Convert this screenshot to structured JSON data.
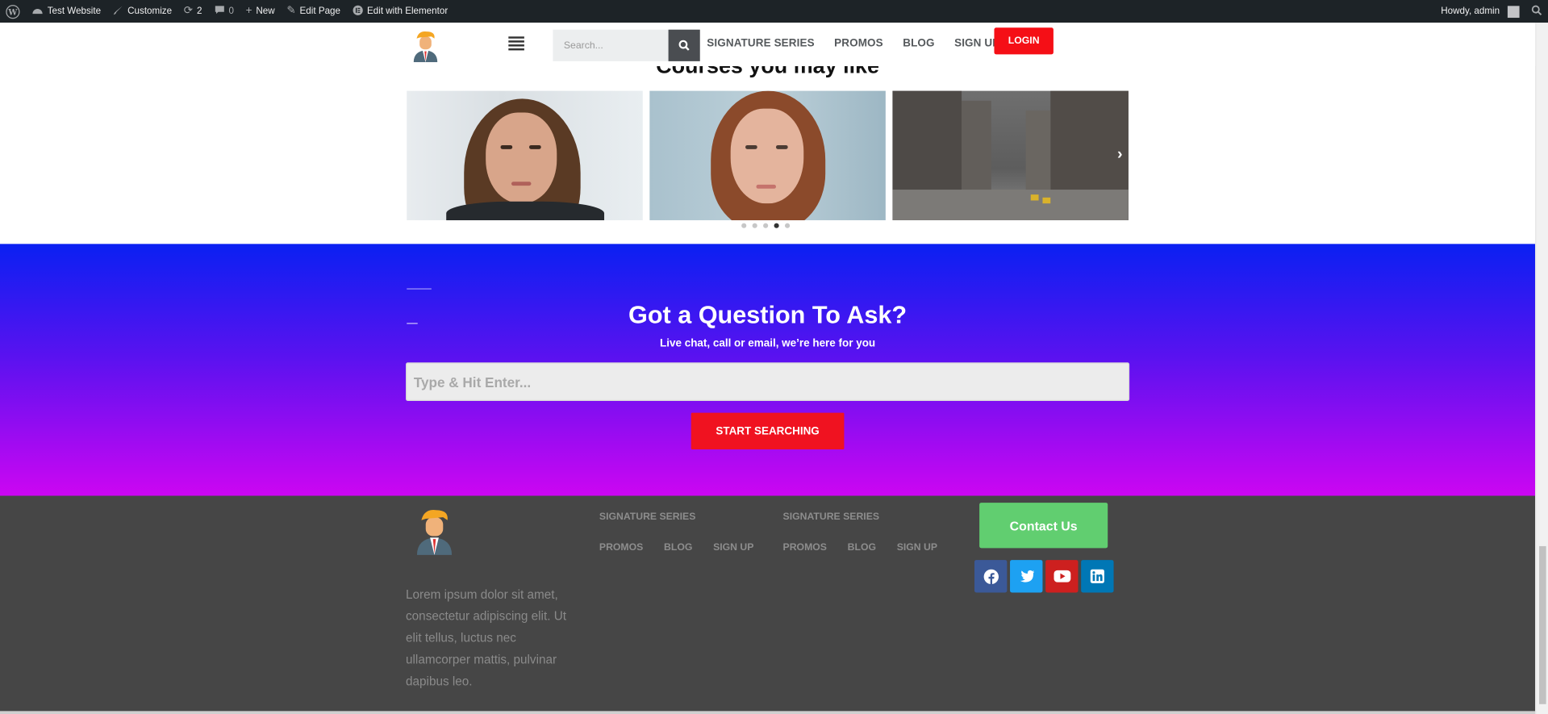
{
  "admin_bar": {
    "site_name": "Test Website",
    "customize": "Customize",
    "updates_count": "2",
    "comments_count": "0",
    "new_label": "New",
    "edit_page": "Edit Page",
    "edit_elementor": "Edit with Elementor",
    "howdy": "Howdy, admin"
  },
  "header": {
    "search_placeholder": "Search...",
    "nav": [
      "SIGNATURE SERIES",
      "PROMOS",
      "BLOG",
      "SIGN UP"
    ],
    "login_label": "LOGIN"
  },
  "courses": {
    "title": "Courses you may like",
    "active_slide": 3,
    "slide_count": 5
  },
  "question": {
    "title": "Got a Question To Ask?",
    "subtitle": "Live chat, call or email, we’re here for you",
    "input_placeholder": "Type & Hit Enter...",
    "button_label": "START SEARCHING"
  },
  "footer": {
    "description": "Lorem ipsum dolor sit amet, consectetur adipiscing elit. Ut elit tellus, luctus nec ullamcorper mattis, pulvinar dapibus leo.",
    "nav1": {
      "top": "SIGNATURE SERIES",
      "items": [
        "PROMOS",
        "BLOG",
        "SIGN UP"
      ]
    },
    "nav2": {
      "top": "SIGNATURE SERIES",
      "items": [
        "PROMOS",
        "BLOG",
        "SIGN UP"
      ]
    },
    "contact_label": "Contact Us",
    "socials": [
      "facebook-icon",
      "twitter-icon",
      "youtube-icon",
      "linkedin-icon"
    ]
  },
  "colors": {
    "login_red": "#f50f16",
    "gradient_top": "#0a20f2",
    "gradient_bottom": "#cc06f2",
    "contact_green": "#61ce70",
    "footer_bg": "#464646"
  }
}
